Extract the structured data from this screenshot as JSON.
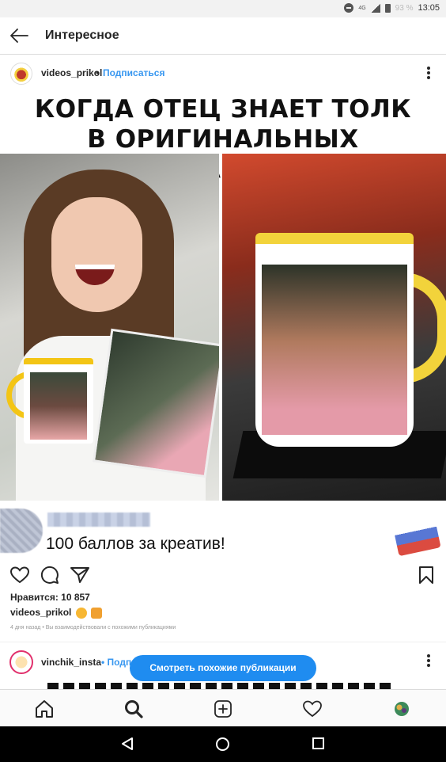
{
  "status_bar": {
    "network": "4G",
    "battery_percent": "93 %",
    "time": "13:05"
  },
  "header": {
    "title": "Интересное",
    "back_icon": "arrow-left-icon"
  },
  "post": {
    "username": "videos_prikol",
    "separator": "•",
    "follow_label": "Подписаться",
    "more_icon": "kebab-vertical-icon",
    "image_text_line1": "КОГДА ОТЕЦ ЗНАЕТ ТОЛК",
    "image_text_line2": "В ОРИГИНАЛЬНЫХ ПОДАРКАХ:",
    "overlay_comment": "100 баллов за креатив!",
    "likes": "Нравится: 10 857",
    "caption_user": "videos_prikol",
    "time_text": "4 дня назад • Вы взаимодействовали с похожими публикациями"
  },
  "actions": {
    "like_icon": "heart-icon",
    "comment_icon": "comment-bubble-icon",
    "share_icon": "paper-plane-icon",
    "save_icon": "bookmark-icon"
  },
  "next_post": {
    "username": "vinchik_insta",
    "separator": "•",
    "follow_label": "Подпи",
    "similar_button": "Смотреть похожие публикации"
  },
  "bottom_nav": [
    {
      "icon": "home-icon"
    },
    {
      "icon": "search-icon"
    },
    {
      "icon": "plus-square-icon"
    },
    {
      "icon": "heart-outline-icon"
    },
    {
      "icon": "profile-avatar-icon"
    }
  ],
  "colors": {
    "accent_blue": "#3897f0",
    "button_blue": "#1f8cf0",
    "text": "#262626"
  }
}
